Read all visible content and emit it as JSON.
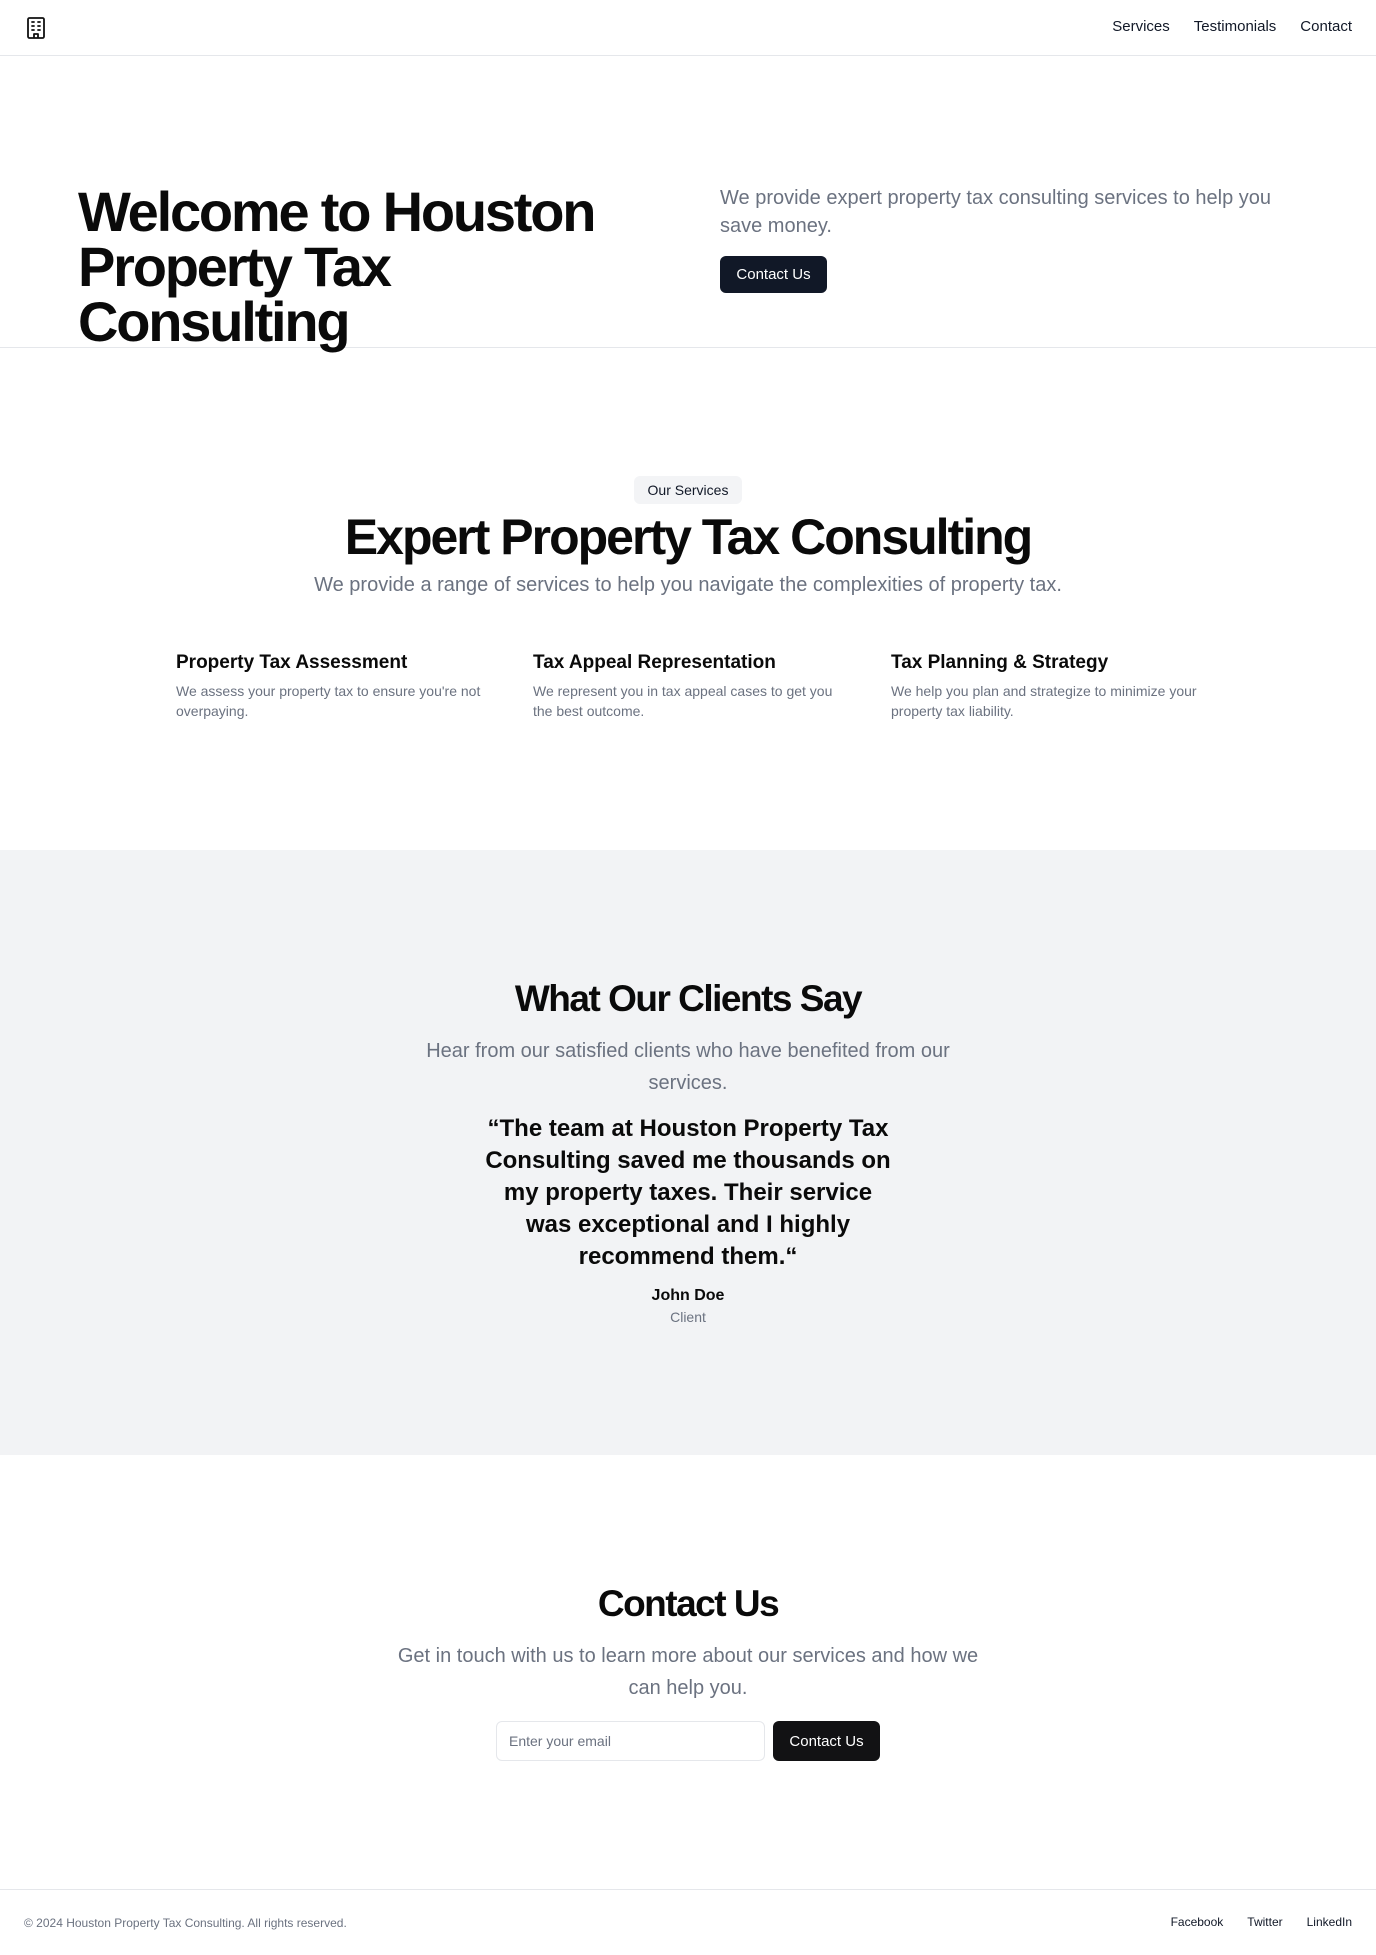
{
  "header": {
    "logo_icon": "building-icon",
    "nav": [
      "Services",
      "Testimonials",
      "Contact"
    ]
  },
  "hero": {
    "title": "Welcome to Houston Property Tax Consulting",
    "description": "We provide expert property tax consulting services to help you save money.",
    "button_label": "Contact Us"
  },
  "services": {
    "badge": "Our Services",
    "title": "Expert Property Tax Consulting",
    "subtitle": "We provide a range of services to help you navigate the complexities of property tax.",
    "items": [
      {
        "title": "Property Tax Assessment",
        "description": "We assess your property tax to ensure you're not overpaying."
      },
      {
        "title": "Tax Appeal Representation",
        "description": "We represent you in tax appeal cases to get you the best outcome."
      },
      {
        "title": "Tax Planning & Strategy",
        "description": "We help you plan and strategize to minimize your property tax liability."
      }
    ]
  },
  "testimonials": {
    "title": "What Our Clients Say",
    "subtitle": "Hear from our satisfied clients who have benefited from our services.",
    "quote": "“The team at Houston Property Tax Consulting saved me thousands on my property taxes. Their service was exceptional and I highly recommend them.“",
    "author": "John Doe",
    "role": "Client"
  },
  "contact": {
    "title": "Contact Us",
    "subtitle": "Get in touch with us to learn more about our services and how we can help you.",
    "email_placeholder": "Enter your email",
    "email_value": "",
    "button_label": "Contact Us"
  },
  "footer": {
    "copyright": "© 2024 Houston Property Tax Consulting. All rights reserved.",
    "links": [
      "Facebook",
      "Twitter",
      "LinkedIn"
    ]
  },
  "colors": {
    "primary_button": "#111827",
    "muted_text": "#6b7280",
    "section_bg": "#f2f3f5",
    "border": "#e5e7eb"
  }
}
